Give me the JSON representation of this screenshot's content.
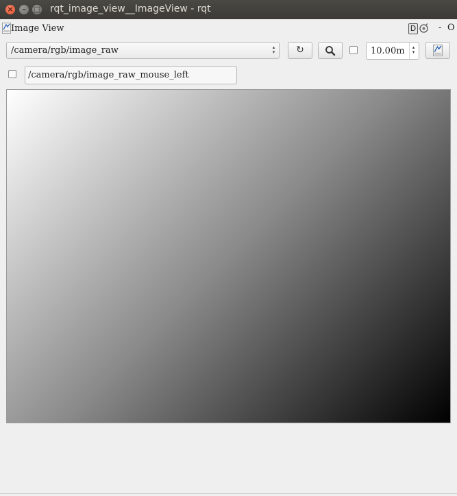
{
  "window": {
    "title": "rqt_image_view__ImageView - rqt",
    "close_glyph": "×",
    "minimize_glyph": "–",
    "maximize_glyph": "□"
  },
  "plugin": {
    "title": "Image View",
    "header_buttons": {
      "d_label": "D",
      "dash": "-",
      "close": "O"
    }
  },
  "controls": {
    "topic_combo": {
      "selected": "/camera/rgb/image_raw",
      "arrows": "▴▾"
    },
    "refresh_icon": "↻",
    "zoom_icon": "search-icon",
    "timeout_spinbox": {
      "value": "10.00m",
      "arrows": "▴▾"
    },
    "mouse_topic": {
      "value": "/camera/rgb/image_raw_mouse_left"
    },
    "checkbox_smooth": {
      "checked": false
    },
    "checkbox_publish_mouse": {
      "checked": false
    }
  },
  "image": {
    "gradient_start": "#ffffff",
    "gradient_end": "#000000"
  },
  "colors": {
    "titlebar": "#3f3e3a",
    "close_button": "#e1502a",
    "background": "#efefef"
  }
}
